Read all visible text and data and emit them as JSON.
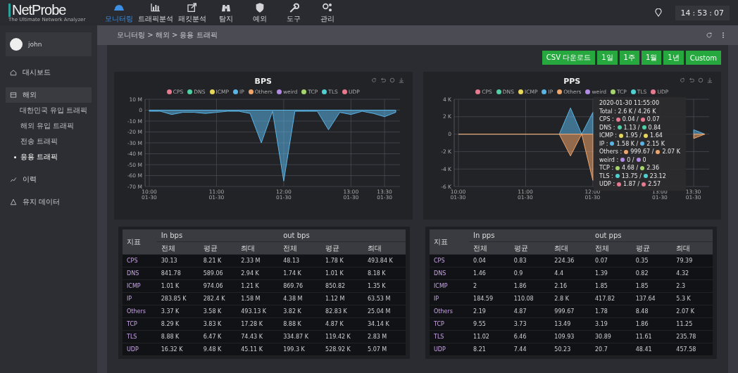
{
  "header": {
    "logo": "NetProbe",
    "tagline": "The Ultimate Network Analyzer",
    "nav": [
      {
        "label": "모니터링",
        "selected": true
      },
      {
        "label": "트래픽분석",
        "selected": false
      },
      {
        "label": "패킷분석",
        "selected": false
      },
      {
        "label": "탐지",
        "selected": false
      },
      {
        "label": "예외",
        "selected": false
      },
      {
        "label": "도구",
        "selected": false
      },
      {
        "label": "관리",
        "selected": false
      }
    ],
    "clock": [
      "14",
      ":",
      "53",
      ":",
      "07"
    ]
  },
  "sidebar": {
    "user": "john",
    "items": [
      {
        "label": "대시보드",
        "selected": false
      },
      {
        "label": "해외",
        "selected": true,
        "children": [
          {
            "label": "대한민국 유입 트래픽",
            "selected": false
          },
          {
            "label": "해외 유입 트래픽",
            "selected": false
          },
          {
            "label": "전송 트래픽",
            "selected": false
          },
          {
            "label": "응용 트래픽",
            "selected": true
          }
        ]
      },
      {
        "label": "이력",
        "selected": false
      },
      {
        "label": "유지 데이터",
        "selected": false
      }
    ]
  },
  "breadcrumb": "모니터링 > 해외 > 응용 트래픽",
  "range_buttons": [
    {
      "label": "CSV 다운로드",
      "selected": false
    },
    {
      "label": "1일",
      "selected": false
    },
    {
      "label": "1주",
      "selected": false
    },
    {
      "label": "1월",
      "selected": false
    },
    {
      "label": "1년",
      "selected": false
    },
    {
      "label": "Custom",
      "selected": false
    }
  ],
  "charts": [
    {
      "chart_data": {
        "type": "area",
        "title": "BPS",
        "ylim": [
          -70,
          10
        ],
        "grid": true,
        "categories": [
          "10:00 01-30",
          null,
          null,
          null,
          null,
          null,
          "11:00 01-30",
          null,
          null,
          null,
          null,
          null,
          "12:00 01-30",
          null,
          null,
          null,
          null,
          null,
          "13:00 01-30",
          null,
          null,
          "13:30 01-30",
          null
        ],
        "yticks": [
          {
            "value": 10,
            "label": "10 M"
          },
          {
            "value": 0,
            "label": "0"
          },
          {
            "value": -10,
            "label": "-10 M"
          },
          {
            "value": -20,
            "label": "-20 M"
          },
          {
            "value": -30,
            "label": "-30 M"
          },
          {
            "value": -40,
            "label": "-40 M"
          },
          {
            "value": -50,
            "label": "-50 M"
          },
          {
            "value": -60,
            "label": "-60 M"
          },
          {
            "value": -70,
            "label": "-70 M"
          }
        ],
        "series": [
          {
            "name": "CPS",
            "color": "#e8798f",
            "values": [
              null,
              null,
              null,
              null,
              null,
              null,
              null,
              null,
              null,
              null,
              null,
              null,
              null,
              null,
              null,
              null,
              null,
              null,
              null,
              null,
              null,
              null,
              null
            ]
          },
          {
            "name": "DNS",
            "color": "#4fd1a5",
            "values": [
              null,
              null,
              null,
              null,
              null,
              null,
              null,
              null,
              null,
              null,
              null,
              null,
              null,
              null,
              null,
              null,
              null,
              null,
              null,
              null,
              null,
              null,
              null
            ]
          },
          {
            "name": "ICMP",
            "color": "#e6d65a",
            "values": [
              null,
              null,
              null,
              null,
              null,
              null,
              null,
              null,
              null,
              null,
              null,
              null,
              null,
              null,
              null,
              null,
              null,
              null,
              null,
              null,
              null,
              null,
              null
            ]
          },
          {
            "name": "IP",
            "color": "#5ab4e6",
            "values": [
              -1,
              -1,
              -4,
              -2,
              -2,
              -3,
              -2,
              -1,
              -1,
              -3,
              -30,
              -1,
              -65,
              -1,
              -1,
              -1,
              -18,
              -2,
              -4,
              -1,
              -3,
              -6,
              -2
            ]
          },
          {
            "name": "Others",
            "color": "#f0a56b",
            "values": [
              null,
              null,
              null,
              null,
              null,
              null,
              null,
              null,
              null,
              null,
              null,
              null,
              null,
              null,
              null,
              null,
              null,
              null,
              null,
              null,
              null,
              null,
              null
            ]
          },
          {
            "name": "weird",
            "color": "#b38be6",
            "values": [
              null,
              null,
              null,
              null,
              null,
              null,
              null,
              null,
              null,
              null,
              null,
              null,
              null,
              null,
              null,
              null,
              null,
              null,
              null,
              null,
              null,
              null,
              null
            ]
          },
          {
            "name": "TCP",
            "color": "#a6d66b",
            "values": [
              null,
              null,
              null,
              null,
              null,
              null,
              null,
              null,
              null,
              null,
              null,
              null,
              null,
              null,
              null,
              null,
              null,
              null,
              null,
              null,
              null,
              null,
              null
            ]
          },
          {
            "name": "TLS",
            "color": "#4fd1d1",
            "values": [
              null,
              null,
              null,
              null,
              null,
              null,
              null,
              null,
              null,
              null,
              null,
              null,
              null,
              null,
              null,
              null,
              null,
              null,
              null,
              null,
              null,
              null,
              null
            ]
          },
          {
            "name": "UDP",
            "color": "#e87a8f",
            "values": [
              null,
              null,
              null,
              null,
              null,
              null,
              null,
              null,
              null,
              null,
              null,
              null,
              null,
              null,
              null,
              null,
              null,
              null,
              null,
              null,
              null,
              null,
              null
            ]
          }
        ]
      }
    },
    {
      "chart_data": {
        "type": "area",
        "title": "PPS",
        "ylim": [
          -6,
          4
        ],
        "grid": true,
        "categories": [
          "10:00 01-30",
          null,
          null,
          null,
          null,
          null,
          "11:00 01-30",
          null,
          null,
          null,
          null,
          null,
          "12:00 01-30",
          null,
          null,
          null,
          null,
          null,
          "13:00 01-30",
          null,
          null,
          "13:30 01-30",
          null
        ],
        "yticks": [
          {
            "value": 4,
            "label": "4 K"
          },
          {
            "value": 2,
            "label": "2 K"
          },
          {
            "value": 0,
            "label": "0"
          },
          {
            "value": -2,
            "label": "-2 K"
          },
          {
            "value": -4,
            "label": "-4 K"
          },
          {
            "value": -6,
            "label": "-6 K"
          }
        ],
        "series": [
          {
            "name": "CPS",
            "color": "#e8798f",
            "values": [
              null,
              null,
              null,
              null,
              null,
              null,
              null,
              null,
              null,
              null,
              null,
              null,
              null,
              null,
              null,
              null,
              null,
              null,
              null,
              null,
              null,
              null,
              null
            ]
          },
          {
            "name": "DNS",
            "color": "#4fd1a5",
            "values": [
              null,
              null,
              null,
              null,
              null,
              null,
              null,
              null,
              null,
              null,
              null,
              null,
              null,
              null,
              null,
              null,
              null,
              null,
              null,
              null,
              null,
              null,
              null
            ]
          },
          {
            "name": "ICMP",
            "color": "#e6d65a",
            "values": [
              null,
              null,
              null,
              null,
              null,
              null,
              null,
              null,
              null,
              null,
              null,
              null,
              null,
              null,
              null,
              null,
              null,
              null,
              null,
              null,
              null,
              null,
              null
            ]
          },
          {
            "name": "IP",
            "color": "#5ab4e6",
            "values": [
              0,
              0,
              0,
              0,
              0,
              0,
              0,
              0,
              0,
              0,
              3,
              0,
              2.5,
              null,
              null,
              null,
              null,
              null,
              null,
              null,
              null,
              0.5,
              0
            ]
          },
          {
            "name": "Others",
            "color": "#f0a56b",
            "values": [
              0,
              0,
              0,
              0,
              0,
              0,
              0,
              0,
              0,
              0,
              -2.5,
              0,
              -5.3,
              null,
              null,
              null,
              null,
              null,
              null,
              null,
              null,
              -0.5,
              0
            ]
          },
          {
            "name": "weird",
            "color": "#b38be6",
            "values": [
              null,
              null,
              null,
              null,
              null,
              null,
              null,
              null,
              null,
              null,
              null,
              null,
              null,
              null,
              null,
              null,
              null,
              null,
              null,
              null,
              null,
              null,
              null
            ]
          },
          {
            "name": "TCP",
            "color": "#a6d66b",
            "values": [
              null,
              null,
              null,
              null,
              null,
              null,
              null,
              null,
              null,
              null,
              null,
              null,
              null,
              null,
              null,
              null,
              null,
              null,
              null,
              null,
              null,
              null,
              null
            ]
          },
          {
            "name": "TLS",
            "color": "#4fd1d1",
            "values": [
              null,
              null,
              null,
              null,
              null,
              null,
              null,
              null,
              null,
              null,
              null,
              null,
              null,
              null,
              null,
              null,
              null,
              null,
              null,
              null,
              null,
              null,
              null
            ]
          },
          {
            "name": "UDP",
            "color": "#e87a8f",
            "values": [
              null,
              null,
              null,
              null,
              null,
              null,
              null,
              null,
              null,
              null,
              null,
              null,
              null,
              null,
              null,
              null,
              null,
              null,
              null,
              null,
              null,
              null,
              null
            ]
          }
        ]
      },
      "tooltip": {
        "time": "2020-01-30 11:55:00",
        "total": "Total : 2.6 K / 4.26 K",
        "rows": [
          {
            "label": "CPS :",
            "color": "#e8798f",
            "in": "0.04 /",
            "out": "0.07"
          },
          {
            "label": "DNS :",
            "color": "#4fd1a5",
            "in": "1.13 /",
            "out": "0.84"
          },
          {
            "label": "ICMP :",
            "color": "#e6d65a",
            "in": "1.95 /",
            "out": "1.64"
          },
          {
            "label": "IP :",
            "color": "#5ab4e6",
            "in": "1.58 K /",
            "out": "2.15 K"
          },
          {
            "label": "Others :",
            "color": "#f0a56b",
            "in": "999.67 /",
            "out": "2.07 K"
          },
          {
            "label": "weird :",
            "color": "#b38be6",
            "in": "0 /",
            "out": "0"
          },
          {
            "label": "TCP :",
            "color": "#a6d66b",
            "in": "4.68 /",
            "out": "2.36"
          },
          {
            "label": "TLS :",
            "color": "#4fd1d1",
            "in": "13.75 /",
            "out": "23.12"
          },
          {
            "label": "UDP :",
            "color": "#e87a8f",
            "in": "1.87 /",
            "out": "2.57"
          }
        ]
      }
    }
  ],
  "tables": [
    {
      "header_rows": [
        [
          {
            "text": "지표",
            "rowspan": 2
          },
          {
            "text": "In bps",
            "colspan": 3
          },
          {
            "text": "out bps",
            "colspan": 3
          }
        ],
        [
          {
            "text": "전체"
          },
          {
            "text": "평균"
          },
          {
            "text": "최대"
          },
          {
            "text": "전체"
          },
          {
            "text": "평균"
          },
          {
            "text": "최대"
          }
        ]
      ],
      "rows": [
        [
          "CPS",
          "30.13",
          "8.21 K",
          "2.33 M",
          "48.13",
          "1.78 K",
          "493.84 K"
        ],
        [
          "DNS",
          "841.78",
          "589.06",
          "2.94 K",
          "1.74 K",
          "1.01 K",
          "8.18 K"
        ],
        [
          "ICMP",
          "1.01 K",
          "974.06",
          "1.21 K",
          "869.76",
          "850.82",
          "1.35 K"
        ],
        [
          "IP",
          "283.85 K",
          "282.4 K",
          "1.58 M",
          "4.38 M",
          "1.12 M",
          "63.53 M"
        ],
        [
          "Others",
          "3.37 K",
          "3.58 K",
          "493.13 K",
          "3.82 K",
          "82.83 K",
          "25.04 M"
        ],
        [
          "TCP",
          "8.29 K",
          "3.83 K",
          "17.28 K",
          "8.88 K",
          "4.87 K",
          "34.14 K"
        ],
        [
          "TLS",
          "8.88 K",
          "6.47 K",
          "74.43 K",
          "334.87 K",
          "119.42 K",
          "2.83 M"
        ],
        [
          "UDP",
          "16.32 K",
          "9.48 K",
          "45.11 K",
          "199.3 K",
          "528.92 K",
          "5.07 M"
        ]
      ]
    },
    {
      "header_rows": [
        [
          {
            "text": "지표",
            "rowspan": 2
          },
          {
            "text": "In pps",
            "colspan": 3
          },
          {
            "text": "out pps",
            "colspan": 3
          }
        ],
        [
          {
            "text": "전체"
          },
          {
            "text": "평균"
          },
          {
            "text": "최대"
          },
          {
            "text": "전체"
          },
          {
            "text": "평균"
          },
          {
            "text": "최대"
          }
        ]
      ],
      "rows": [
        [
          "CPS",
          "0.04",
          "0.83",
          "224.36",
          "0.07",
          "0.35",
          "79.39"
        ],
        [
          "DNS",
          "1.46",
          "0.9",
          "4.4",
          "1.39",
          "0.82",
          "4.32"
        ],
        [
          "ICMP",
          "2",
          "1.86",
          "2.16",
          "1.85",
          "1.85",
          "2.3"
        ],
        [
          "IP",
          "184.59",
          "110.08",
          "2.8 K",
          "417.82",
          "137.64",
          "5.3 K"
        ],
        [
          "Others",
          "2.19",
          "4.87",
          "999.67",
          "1.78",
          "8.48",
          "2.07 K"
        ],
        [
          "TCP",
          "9.55",
          "3.73",
          "13.49",
          "3.19",
          "1.86",
          "11.25"
        ],
        [
          "TLS",
          "11.02",
          "6.46",
          "109.93",
          "30.89",
          "11.61",
          "235.78"
        ],
        [
          "UDP",
          "8.21",
          "7.44",
          "50.23",
          "20.7",
          "48.41",
          "457.58"
        ]
      ]
    }
  ]
}
